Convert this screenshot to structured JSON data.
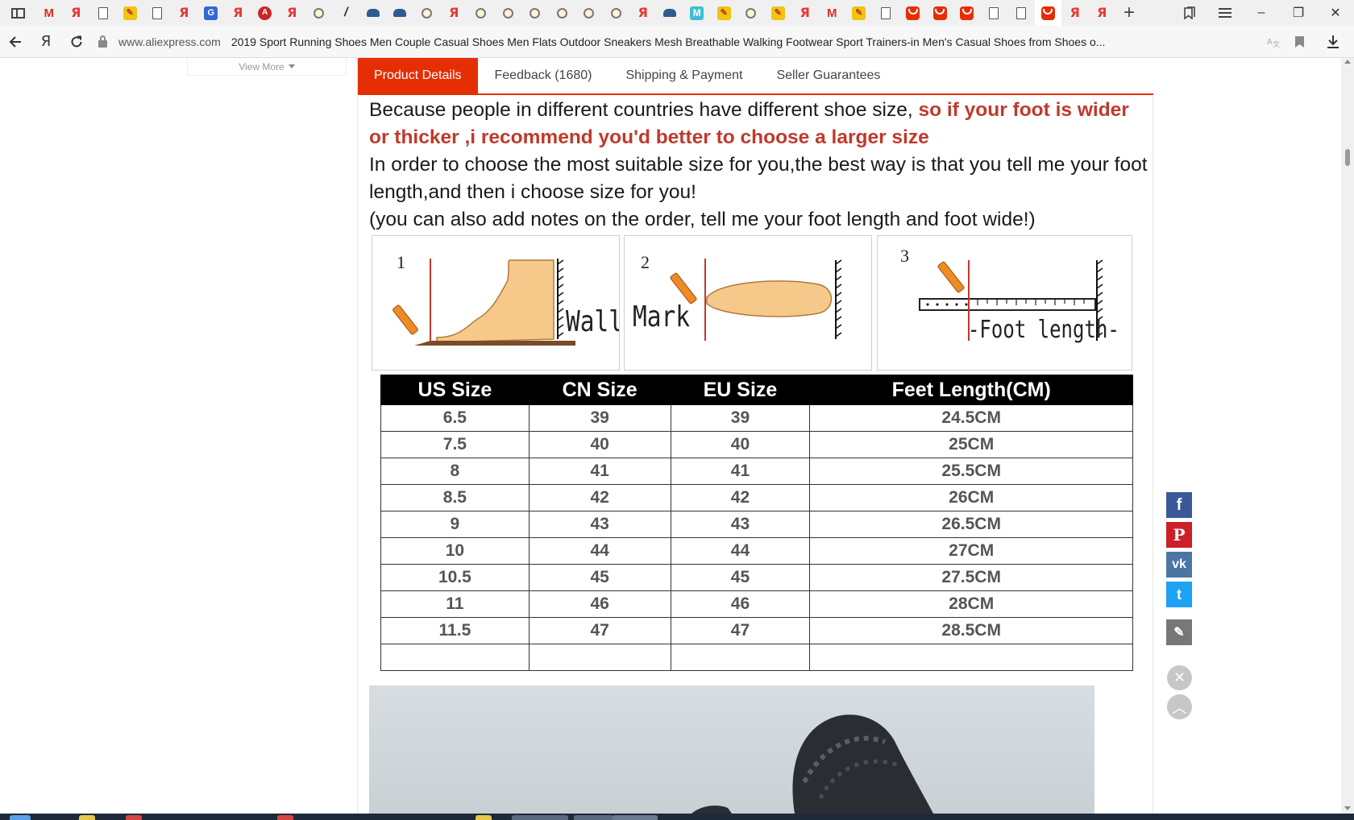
{
  "browser": {
    "tabs": [
      "sidebar",
      "gmail",
      "yandex",
      "doc",
      "dn",
      "doc",
      "yandex",
      "translate",
      "yandex",
      "abp",
      "yandex",
      "magnifier",
      "slash",
      "car",
      "car",
      "magnifier",
      "yandex",
      "magnifier",
      "magnifier",
      "magnifier",
      "magnifier",
      "magnifier",
      "magnifier",
      "yandex",
      "car",
      "m",
      "dn",
      "magnifier",
      "dn",
      "yandex",
      "gmail",
      "dn",
      "doc",
      "aliexpress",
      "aliexpress",
      "aliexpress",
      "doc",
      "doc",
      "aliexpress",
      "yandex",
      "yandex"
    ],
    "active_tab_index": 38,
    "window_controls": {
      "minimize": "–",
      "restore": "❐",
      "close": "✕"
    },
    "url_domain": "www.aliexpress.com",
    "url_title": "2019 Sport Running Shoes Men Couple Casual Shoes Men Flats Outdoor Sneakers Mesh Breathable Walking Footwear Sport Trainers-in Men's Casual Shoes from Shoes o..."
  },
  "sidebar": {
    "view_more": "View More"
  },
  "product_tabs": [
    {
      "label": "Product Details",
      "active": true
    },
    {
      "label": "Feedback (1680)",
      "active": false
    },
    {
      "label": "Shipping & Payment",
      "active": false
    },
    {
      "label": "Seller Guarantees",
      "active": false
    }
  ],
  "description": {
    "line1_plain": "Because people in different countries have different shoe size, ",
    "line1_red": "so if your foot is wider or thicker ,i recommend you'd better to choose a larger size",
    "line2": "In order to choose the most suitable size for you,the best way is that you tell me your foot length,and then i choose size for you!",
    "line3": "(you can also add notes on the order, tell me your foot length and foot wide!)"
  },
  "diagrams": [
    {
      "number": "1",
      "label": "Wall"
    },
    {
      "number": "2",
      "label": "Mark"
    },
    {
      "number": "3",
      "label": "-Foot length-"
    }
  ],
  "size_table": {
    "headers": [
      "US Size",
      "CN Size",
      "EU Size",
      "Feet Length(CM)"
    ],
    "rows": [
      [
        "6.5",
        "39",
        "39",
        "24.5CM"
      ],
      [
        "7.5",
        "40",
        "40",
        "25CM"
      ],
      [
        "8",
        "41",
        "41",
        "25.5CM"
      ],
      [
        "8.5",
        "42",
        "42",
        "26CM"
      ],
      [
        "9",
        "43",
        "43",
        "26.5CM"
      ],
      [
        "10",
        "44",
        "44",
        "27CM"
      ],
      [
        "10.5",
        "45",
        "45",
        "27.5CM"
      ],
      [
        "11",
        "46",
        "46",
        "28CM"
      ],
      [
        "11.5",
        "47",
        "47",
        "28.5CM"
      ],
      [
        "",
        "",
        "",
        ""
      ]
    ]
  },
  "share_buttons": [
    {
      "name": "facebook",
      "glyph": "f"
    },
    {
      "name": "pinterest",
      "glyph": "P"
    },
    {
      "name": "vk",
      "glyph": "vk"
    },
    {
      "name": "twitter",
      "glyph": "t"
    },
    {
      "name": "edit",
      "glyph": "✎"
    }
  ],
  "floating": {
    "close": "✕",
    "top": "︿"
  },
  "colors": {
    "accent": "#e62e04",
    "red_text": "#c0392b",
    "table_header_bg": "#000000"
  }
}
